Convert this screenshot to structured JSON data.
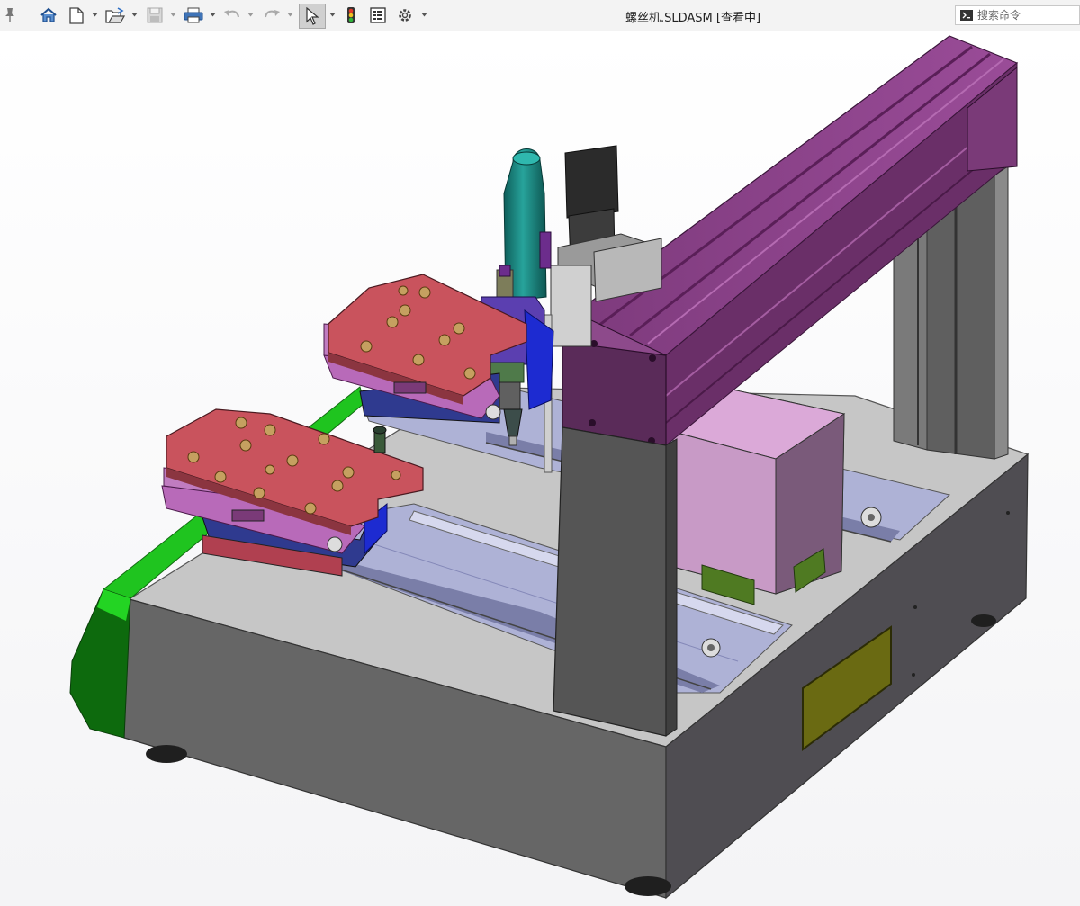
{
  "window": {
    "title": "螺丝机.SLDASM [查看中]"
  },
  "command_search": {
    "placeholder": "搜索命令"
  },
  "toolbar": {
    "icons": [
      "pin-icon",
      "home-icon",
      "new-document-icon",
      "open-icon",
      "save-icon",
      "print-icon",
      "undo-icon",
      "redo-icon",
      "select-icon",
      "rebuild-icon",
      "file-properties-icon",
      "options-icon"
    ]
  },
  "view_toolbar": {
    "icons": [
      "zoom-to-fit-icon",
      "zoom-to-area-icon",
      "previous-view-icon",
      "section-view-icon",
      "view-orientation-icon",
      "display-style-icon",
      "hide-show-items-icon",
      "edit-appearance-icon",
      "apply-scene-icon",
      "view-settings-icon"
    ]
  },
  "model": {
    "name": "螺丝机",
    "colors": {
      "base_top": "#c6c6c6",
      "base_front": "#666666",
      "base_side": "#4f4d52",
      "green_trim": "#1fc41f",
      "gantry_purple": "#8a3f88",
      "fixture_red": "#c9535d",
      "fixture_pink": "#b86ab9",
      "tool_teal": "#17807a",
      "cabinet_pink": "#c89ac6",
      "window_yellow": "#6a6a12"
    }
  }
}
